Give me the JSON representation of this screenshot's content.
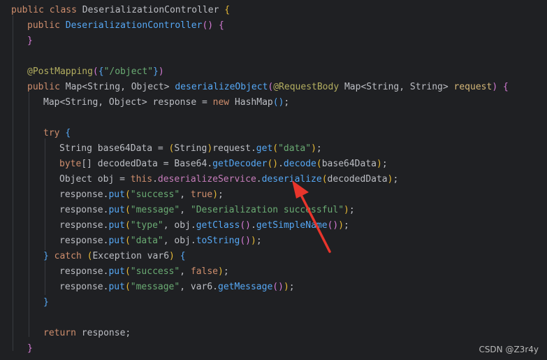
{
  "code_lines": [
    {
      "indent": 0,
      "tokens": [
        {
          "t": "public class ",
          "c": "kw"
        },
        {
          "t": "DeserializationController ",
          "c": "cls"
        },
        {
          "t": "{",
          "c": "br1"
        }
      ]
    },
    {
      "indent": 1,
      "tokens": [
        {
          "t": "public ",
          "c": "kw"
        },
        {
          "t": "DeserializationController",
          "c": "fn"
        },
        {
          "t": "() ",
          "c": "br2"
        },
        {
          "t": "{",
          "c": "br2"
        }
      ]
    },
    {
      "indent": 1,
      "tokens": [
        {
          "t": "}",
          "c": "br2"
        }
      ]
    },
    {
      "indent": 0,
      "tokens": []
    },
    {
      "indent": 1,
      "tokens": [
        {
          "t": "@PostMapping",
          "c": "an"
        },
        {
          "t": "(",
          "c": "br2"
        },
        {
          "t": "{",
          "c": "br3"
        },
        {
          "t": "\"/object\"",
          "c": "st"
        },
        {
          "t": "}",
          "c": "br3"
        },
        {
          "t": ")",
          "c": "br2"
        }
      ]
    },
    {
      "indent": 1,
      "tokens": [
        {
          "t": "public ",
          "c": "kw"
        },
        {
          "t": "Map<String, Object> ",
          "c": "pl"
        },
        {
          "t": "deserializeObject",
          "c": "fn"
        },
        {
          "t": "(",
          "c": "br2"
        },
        {
          "t": "@RequestBody ",
          "c": "an"
        },
        {
          "t": "Map<String, String> ",
          "c": "pl"
        },
        {
          "t": "request",
          "c": "pa"
        },
        {
          "t": ") ",
          "c": "br2"
        },
        {
          "t": "{",
          "c": "br2"
        }
      ]
    },
    {
      "indent": 2,
      "tokens": [
        {
          "t": "Map<String, Object> response = ",
          "c": "pl"
        },
        {
          "t": "new ",
          "c": "kw"
        },
        {
          "t": "HashMap",
          "c": "pl"
        },
        {
          "t": "()",
          "c": "br3"
        },
        {
          "t": ";",
          "c": "pl"
        }
      ]
    },
    {
      "indent": 0,
      "tokens": []
    },
    {
      "indent": 2,
      "tokens": [
        {
          "t": "try ",
          "c": "kw"
        },
        {
          "t": "{",
          "c": "br3"
        }
      ]
    },
    {
      "indent": 3,
      "tokens": [
        {
          "t": "String base64Data = ",
          "c": "pl"
        },
        {
          "t": "(",
          "c": "br1"
        },
        {
          "t": "String",
          "c": "pl"
        },
        {
          "t": ")",
          "c": "br1"
        },
        {
          "t": "request.",
          "c": "pl"
        },
        {
          "t": "get",
          "c": "fn"
        },
        {
          "t": "(",
          "c": "br1"
        },
        {
          "t": "\"data\"",
          "c": "st"
        },
        {
          "t": ")",
          "c": "br1"
        },
        {
          "t": ";",
          "c": "pl"
        }
      ]
    },
    {
      "indent": 3,
      "tokens": [
        {
          "t": "byte",
          "c": "kw"
        },
        {
          "t": "[] decodedData = Base64.",
          "c": "pl"
        },
        {
          "t": "getDecoder",
          "c": "fn"
        },
        {
          "t": "()",
          "c": "br1"
        },
        {
          "t": ".",
          "c": "pl"
        },
        {
          "t": "decode",
          "c": "fn"
        },
        {
          "t": "(",
          "c": "br1"
        },
        {
          "t": "base64Data",
          "c": "pl"
        },
        {
          "t": ")",
          "c": "br1"
        },
        {
          "t": ";",
          "c": "pl"
        }
      ]
    },
    {
      "indent": 3,
      "tokens": [
        {
          "t": "Object obj = ",
          "c": "pl"
        },
        {
          "t": "this",
          "c": "kw"
        },
        {
          "t": ".",
          "c": "pl"
        },
        {
          "t": "deserializeService",
          "c": "fld"
        },
        {
          "t": ".",
          "c": "pl"
        },
        {
          "t": "deserialize",
          "c": "fn"
        },
        {
          "t": "(",
          "c": "br1"
        },
        {
          "t": "decodedData",
          "c": "pl"
        },
        {
          "t": ")",
          "c": "br1"
        },
        {
          "t": ";",
          "c": "pl"
        }
      ]
    },
    {
      "indent": 3,
      "tokens": [
        {
          "t": "response.",
          "c": "pl"
        },
        {
          "t": "put",
          "c": "fn"
        },
        {
          "t": "(",
          "c": "br1"
        },
        {
          "t": "\"success\"",
          "c": "st"
        },
        {
          "t": ", ",
          "c": "pl"
        },
        {
          "t": "true",
          "c": "kw"
        },
        {
          "t": ")",
          "c": "br1"
        },
        {
          "t": ";",
          "c": "pl"
        }
      ]
    },
    {
      "indent": 3,
      "tokens": [
        {
          "t": "response.",
          "c": "pl"
        },
        {
          "t": "put",
          "c": "fn"
        },
        {
          "t": "(",
          "c": "br1"
        },
        {
          "t": "\"message\"",
          "c": "st"
        },
        {
          "t": ", ",
          "c": "pl"
        },
        {
          "t": "\"Deserialization successful\"",
          "c": "st"
        },
        {
          "t": ")",
          "c": "br1"
        },
        {
          "t": ";",
          "c": "pl"
        }
      ]
    },
    {
      "indent": 3,
      "tokens": [
        {
          "t": "response.",
          "c": "pl"
        },
        {
          "t": "put",
          "c": "fn"
        },
        {
          "t": "(",
          "c": "br1"
        },
        {
          "t": "\"type\"",
          "c": "st"
        },
        {
          "t": ", obj.",
          "c": "pl"
        },
        {
          "t": "getClass",
          "c": "fn"
        },
        {
          "t": "()",
          "c": "br2"
        },
        {
          "t": ".",
          "c": "pl"
        },
        {
          "t": "getSimpleName",
          "c": "fn"
        },
        {
          "t": "()",
          "c": "br2"
        },
        {
          "t": ")",
          "c": "br1"
        },
        {
          "t": ";",
          "c": "pl"
        }
      ]
    },
    {
      "indent": 3,
      "tokens": [
        {
          "t": "response.",
          "c": "pl"
        },
        {
          "t": "put",
          "c": "fn"
        },
        {
          "t": "(",
          "c": "br1"
        },
        {
          "t": "\"data\"",
          "c": "st"
        },
        {
          "t": ", obj.",
          "c": "pl"
        },
        {
          "t": "toString",
          "c": "fn"
        },
        {
          "t": "()",
          "c": "br2"
        },
        {
          "t": ")",
          "c": "br1"
        },
        {
          "t": ";",
          "c": "pl"
        }
      ]
    },
    {
      "indent": 2,
      "tokens": [
        {
          "t": "} ",
          "c": "br3"
        },
        {
          "t": "catch ",
          "c": "kw"
        },
        {
          "t": "(",
          "c": "br1"
        },
        {
          "t": "Exception var6",
          "c": "pl"
        },
        {
          "t": ") ",
          "c": "br1"
        },
        {
          "t": "{",
          "c": "br3"
        }
      ]
    },
    {
      "indent": 3,
      "tokens": [
        {
          "t": "response.",
          "c": "pl"
        },
        {
          "t": "put",
          "c": "fn"
        },
        {
          "t": "(",
          "c": "br1"
        },
        {
          "t": "\"success\"",
          "c": "st"
        },
        {
          "t": ", ",
          "c": "pl"
        },
        {
          "t": "false",
          "c": "kw"
        },
        {
          "t": ")",
          "c": "br1"
        },
        {
          "t": ";",
          "c": "pl"
        }
      ]
    },
    {
      "indent": 3,
      "tokens": [
        {
          "t": "response.",
          "c": "pl"
        },
        {
          "t": "put",
          "c": "fn"
        },
        {
          "t": "(",
          "c": "br1"
        },
        {
          "t": "\"message\"",
          "c": "st"
        },
        {
          "t": ", var6.",
          "c": "pl"
        },
        {
          "t": "getMessage",
          "c": "fn"
        },
        {
          "t": "()",
          "c": "br2"
        },
        {
          "t": ")",
          "c": "br1"
        },
        {
          "t": ";",
          "c": "pl"
        }
      ]
    },
    {
      "indent": 2,
      "tokens": [
        {
          "t": "}",
          "c": "br3"
        }
      ]
    },
    {
      "indent": 0,
      "tokens": []
    },
    {
      "indent": 2,
      "tokens": [
        {
          "t": "return ",
          "c": "kw"
        },
        {
          "t": "response;",
          "c": "pl"
        }
      ]
    },
    {
      "indent": 1,
      "tokens": [
        {
          "t": "}",
          "c": "br2"
        }
      ]
    }
  ],
  "watermark": "CSDN @Z3r4y",
  "annotation": {
    "type": "arrow",
    "color": "#e8352c",
    "points_to": "deserialize"
  },
  "theme": {
    "background": "#1f2023"
  }
}
